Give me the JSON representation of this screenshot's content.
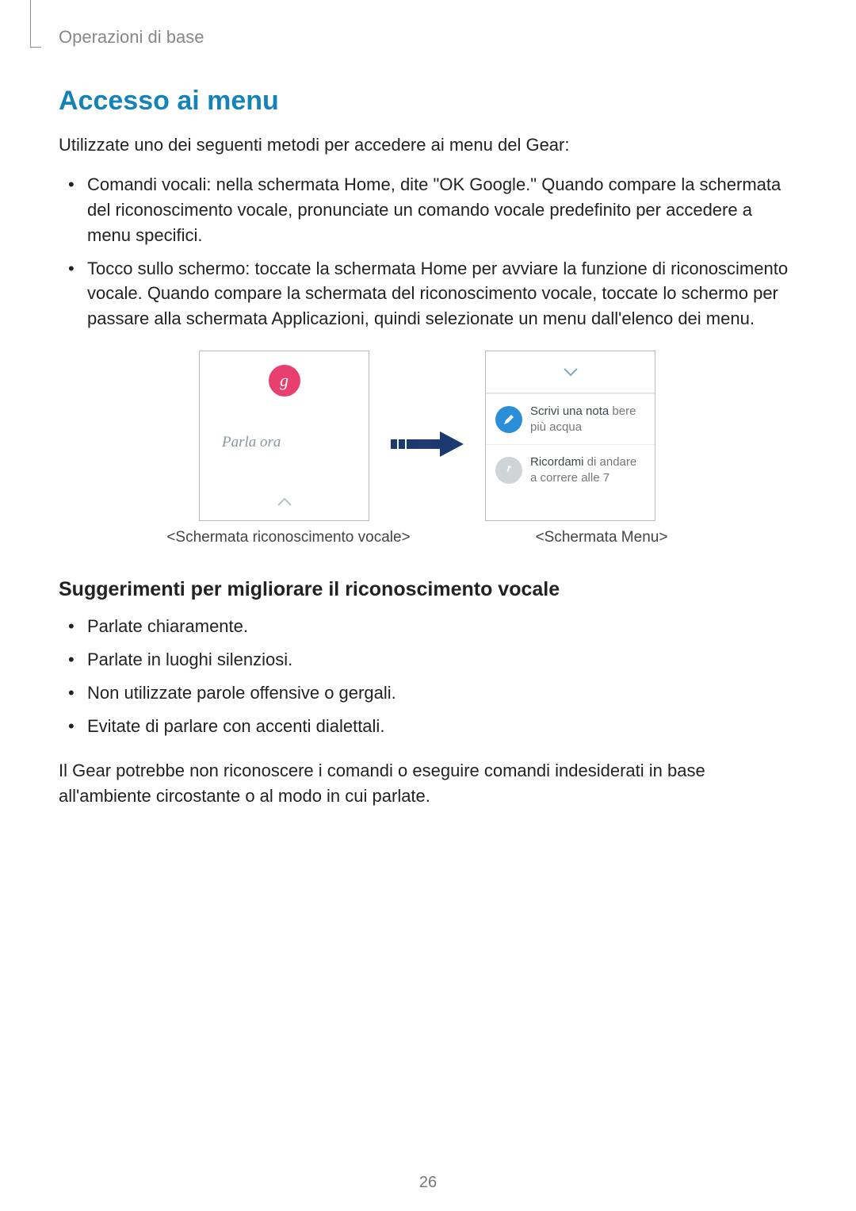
{
  "header": {
    "breadcrumb": "Operazioni di base"
  },
  "title": "Accesso ai menu",
  "intro": "Utilizzate uno dei seguenti metodi per accedere ai menu del Gear:",
  "methods": [
    "Comandi vocali: nella schermata Home, dite \"OK Google.\" Quando compare la schermata del riconoscimento vocale, pronunciate un comando vocale predefinito per accedere a menu specifici.",
    "Tocco sullo schermo: toccate la schermata Home per avviare la funzione di riconoscimento vocale. Quando compare la schermata del riconoscimento vocale, toccate lo schermo per passare alla schermata Applicazioni, quindi selezionate un menu dall'elenco dei menu."
  ],
  "figure": {
    "screen1": {
      "g_label": "g",
      "prompt": "Parla ora"
    },
    "screen2": {
      "row1_strong": "Scrivi una nota",
      "row1_rest": " bere più acqua",
      "row2_strong": "Ricordami",
      "row2_rest": " di andare a correre alle 7"
    },
    "caption_left": "<Schermata riconoscimento vocale>",
    "caption_right": "<Schermata Menu>"
  },
  "subhead": "Suggerimenti per migliorare il riconoscimento vocale",
  "tips": [
    "Parlate chiaramente.",
    "Parlate in luoghi silenziosi.",
    "Non utilizzate parole offensive o gergali.",
    "Evitate di parlare con accenti dialettali."
  ],
  "closing": "Il Gear potrebbe non riconoscere i comandi o eseguire comandi indesiderati in base all'ambiente circostante o al modo in cui parlate.",
  "page_number": "26"
}
